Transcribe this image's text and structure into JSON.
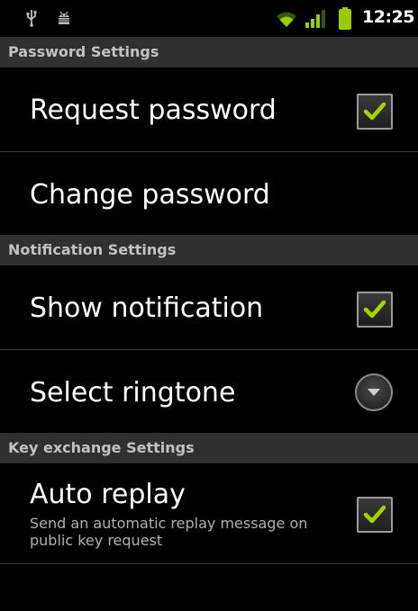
{
  "statusbar": {
    "time": "12:25",
    "icons": [
      "usb-icon",
      "android-debug-icon",
      "wifi-icon",
      "signal-icon",
      "battery-icon"
    ],
    "accent_color": "#99cc00"
  },
  "sections": [
    {
      "header": "Password Settings",
      "items": [
        {
          "title": "Request password",
          "control": "checkbox",
          "checked": true
        },
        {
          "title": "Change password",
          "control": "none"
        }
      ]
    },
    {
      "header": "Notification Settings",
      "items": [
        {
          "title": "Show notification",
          "control": "checkbox",
          "checked": true
        },
        {
          "title": "Select ringtone",
          "control": "dropdown"
        }
      ]
    },
    {
      "header": "Key exchange Settings",
      "items": [
        {
          "title": "Auto replay",
          "summary": "Send an automatic replay message on public key request",
          "control": "checkbox",
          "checked": true
        }
      ]
    }
  ]
}
